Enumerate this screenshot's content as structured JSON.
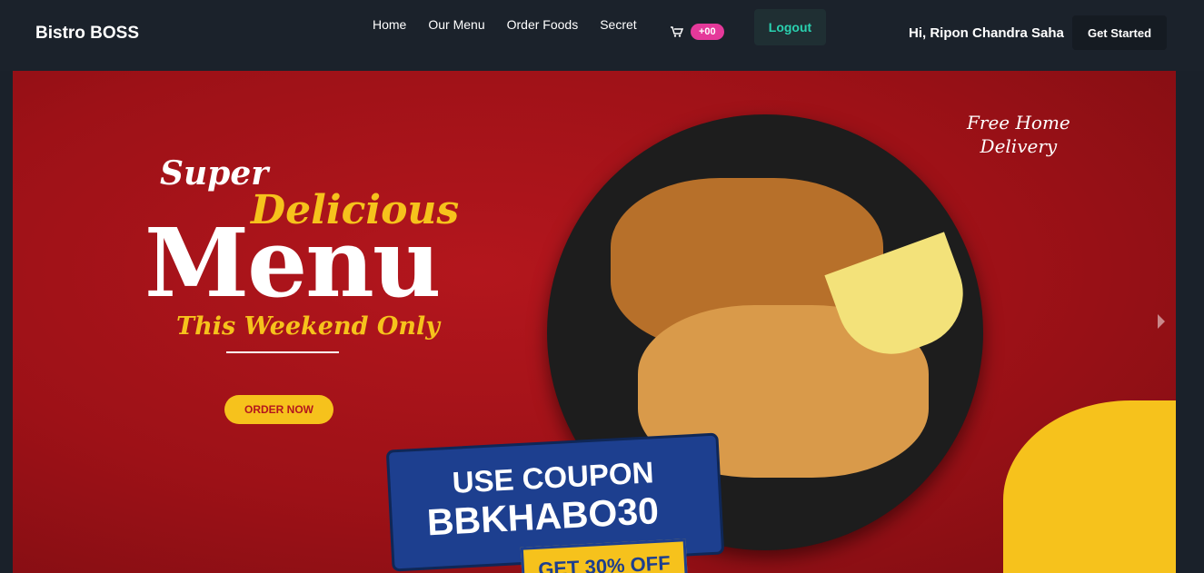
{
  "navbar": {
    "brand": "Bistro BOSS",
    "links": [
      "Home",
      "Our Menu",
      "Order Foods",
      "Secret"
    ],
    "cart_count": "+00",
    "logout": "Logout",
    "greeting": "Hi, Ripon Chandra Saha",
    "get_started": "Get Started"
  },
  "banner": {
    "super": "Super",
    "delicious": "Delicious",
    "menu": "Menu",
    "weekend": "This Weekend Only",
    "order_now": "ORDER NOW",
    "free_delivery": [
      "Free Home",
      "Delivery"
    ],
    "coupon_title": "USE COUPON",
    "coupon_code": "BBKHABO30",
    "offer": "GET 30% OFF"
  }
}
